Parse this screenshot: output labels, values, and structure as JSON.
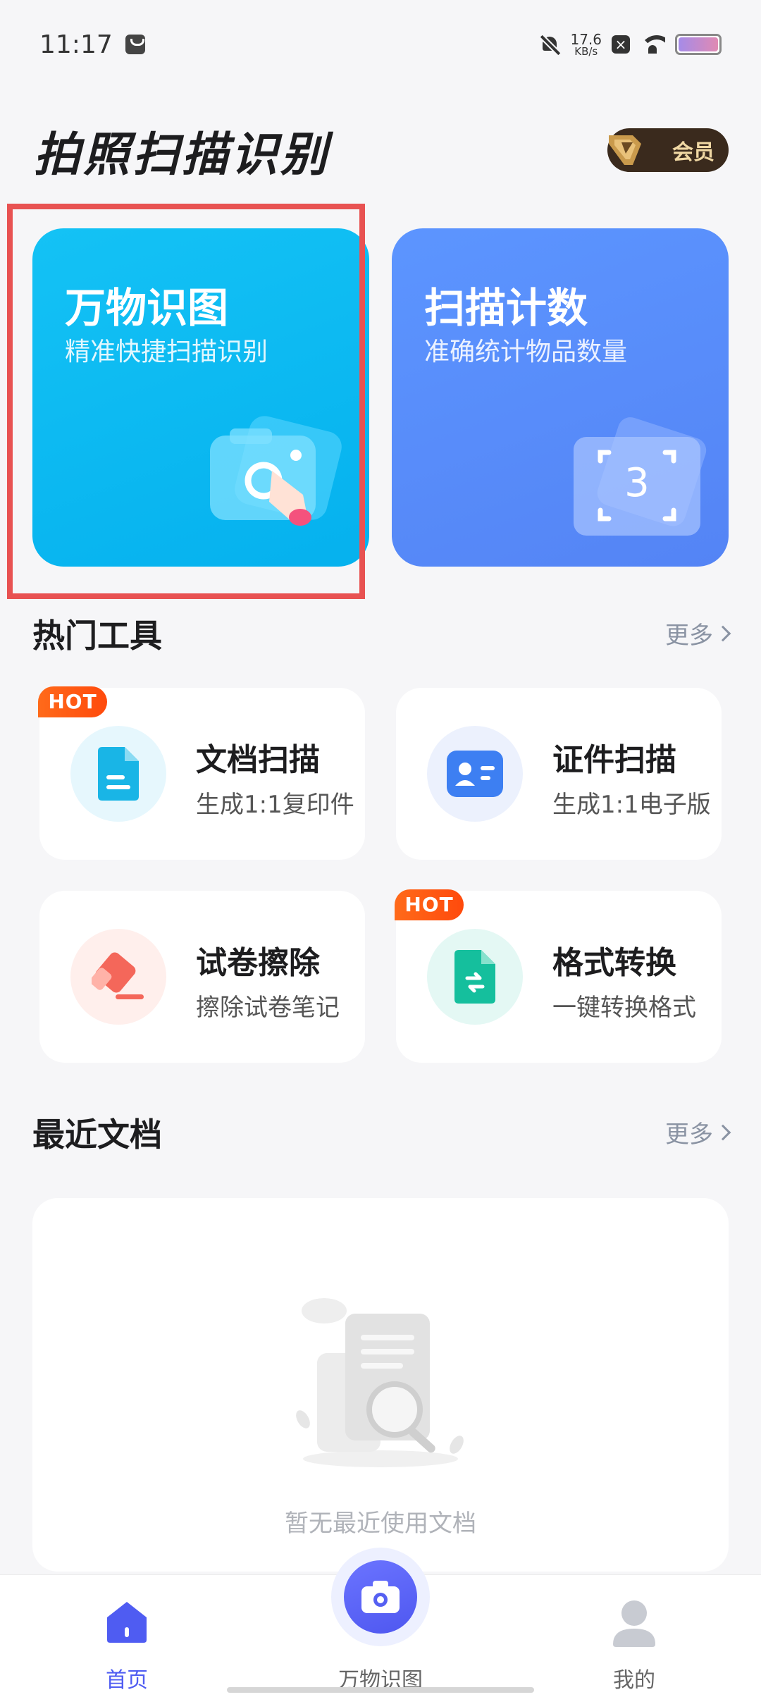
{
  "status_bar": {
    "time": "11:17",
    "net_speed_value": "17.6",
    "net_speed_unit": "KB/s"
  },
  "header": {
    "title": "拍照扫描识别",
    "vip_label": "会员"
  },
  "feature_cards": [
    {
      "title": "万物识图",
      "subtitle": "精准快捷扫描识别"
    },
    {
      "title": "扫描计数",
      "subtitle": "准确统计物品数量",
      "count_display": "3"
    }
  ],
  "hot_tools": {
    "title": "热门工具",
    "more_label": "更多",
    "items": [
      {
        "name": "文档扫描",
        "desc": "生成1:1复印件",
        "badge": "HOT",
        "icon": "document-icon"
      },
      {
        "name": "证件扫描",
        "desc": "生成1:1电子版",
        "icon": "id-card-icon"
      },
      {
        "name": "试卷擦除",
        "desc": "擦除试卷笔记",
        "icon": "eraser-icon"
      },
      {
        "name": "格式转换",
        "desc": "一键转换格式",
        "badge": "HOT",
        "icon": "convert-icon"
      }
    ]
  },
  "recent_docs": {
    "title": "最近文档",
    "more_label": "更多",
    "empty_text": "暂无最近使用文档"
  },
  "bottom_nav": {
    "items": [
      {
        "label": "首页",
        "icon": "home-icon",
        "active": true
      },
      {
        "label": "万物识图",
        "icon": "camera-icon"
      },
      {
        "label": "我的",
        "icon": "profile-icon"
      }
    ]
  },
  "colors": {
    "accent": "#4f5cf2",
    "card_recognize": "#0fbaf2",
    "card_count": "#5a8cfb",
    "hot_badge": "#ff5a12",
    "highlight_box": "#e85252"
  }
}
